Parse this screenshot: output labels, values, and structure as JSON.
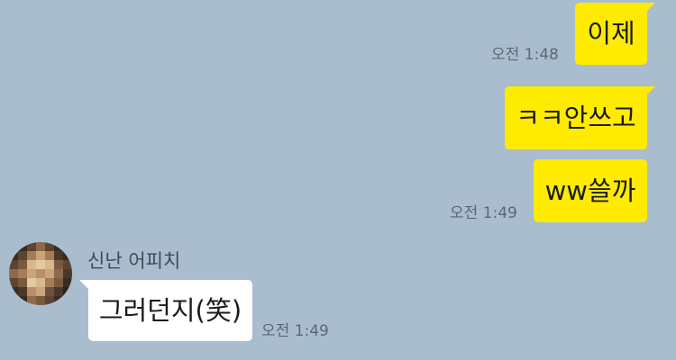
{
  "messages": [
    {
      "direction": "outgoing",
      "text": "이제",
      "time": "오전 1:48"
    },
    {
      "direction": "outgoing",
      "text": "ㅋㅋ안쓰고"
    },
    {
      "direction": "outgoing",
      "text": "ww쓸까",
      "time": "오전 1:49"
    },
    {
      "direction": "incoming",
      "sender": "신난 어피치",
      "avatar": "pixelated-profile-photo",
      "text": "그러던지(笑)",
      "time": "오전 1:49"
    }
  ],
  "colors": {
    "background": "#a9bdce",
    "outgoing_bubble": "#ffeb00",
    "incoming_bubble": "#ffffff",
    "timestamp": "#5b6874"
  }
}
